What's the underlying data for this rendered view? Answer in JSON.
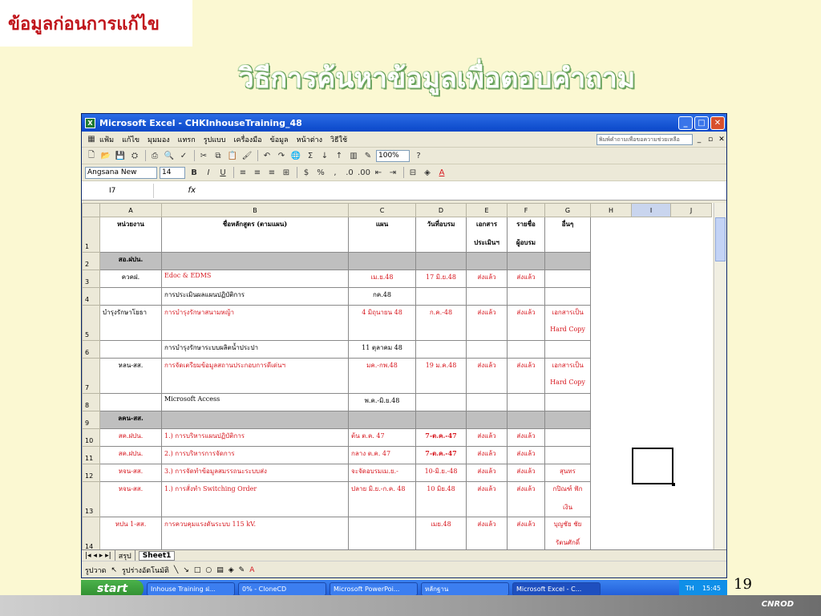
{
  "slide": {
    "tag": "ข้อมูลก่อนการแก้ไข",
    "title": "วิธีการค้นหาข้อมูลเพื่อตอบคำถาม",
    "page_number": "19",
    "footer": "CNROD"
  },
  "excel": {
    "window_title": "Microsoft Excel - CHKInhouseTraining_48",
    "menu": [
      "แฟ้ม",
      "แก้ไข",
      "มุมมอง",
      "แทรก",
      "รูปแบบ",
      "เครื่องมือ",
      "ข้อมูล",
      "หน้าต่าง",
      "วิธีใช้"
    ],
    "help_placeholder": "พิมพ์คำถามเพื่อขอความช่วยเหลือ",
    "font_name": "Angsana New",
    "font_size": "14",
    "zoom": "100%",
    "name_box": "I7",
    "fx_label": "fx",
    "columns": [
      "A",
      "B",
      "C",
      "D",
      "E",
      "F",
      "G",
      "H",
      "I",
      "J"
    ],
    "rows": [
      {
        "n": "1",
        "a": "หน่วยงาน",
        "b": "ชื่อหลักสูตร (ตามแผน)",
        "c": "แผน",
        "d": "วันที่อบรม",
        "e": "เอกสาร",
        "f": "รายชื่อ",
        "g": "อื่นๆ",
        "e2": "ประเมินฯ",
        "f2": "ผู้อบรม"
      },
      {
        "n": "2",
        "a": "สอ.ฝปน.",
        "gray": true
      },
      {
        "n": "3",
        "a": "ควคฝ.",
        "b": "Edoc & EDMS",
        "c": "เม.ย.48",
        "d": "17 มิ.ย.48",
        "e": "ส่งแล้ว",
        "f": "ส่งแล้ว",
        "g": ""
      },
      {
        "n": "4",
        "a": "",
        "b": "การประเมินผลแผนปฏิบัติการ",
        "c": "กค.48",
        "d": "",
        "e": "",
        "f": "",
        "g": ""
      },
      {
        "n": "5",
        "a": "บำรุงรักษาโยธา",
        "b": "การบำรุงรักษาสนามหญ้า",
        "c": "4 มิถุนายน 48",
        "d": "ก.ค.-48",
        "e": "ส่งแล้ว",
        "f": "ส่งแล้ว",
        "g": "เอกสารเป็น",
        "g2": "Hard Copy"
      },
      {
        "n": "6",
        "a": "",
        "b": "การบำรุงรักษาระบบผลิตน้ำประปา",
        "c": "11 ตุลาคม 48",
        "d": "",
        "e": "",
        "f": "",
        "g": ""
      },
      {
        "n": "7",
        "a": "หลน-สส.",
        "b": "การจัดเตรียมข้อมูลสถานประกอบการดีเด่นฯ",
        "c": "มค.-กพ.48",
        "d": "19 ม.ค.48",
        "e": "ส่งแล้ว",
        "f": "ส่งแล้ว",
        "g": "เอกสารเป็น",
        "g2": "Hard Copy"
      },
      {
        "n": "8",
        "a": "",
        "b": "Microsoft Access",
        "c": "พ.ค.-มิ.ย.48",
        "d": "",
        "e": "",
        "f": "",
        "g": ""
      },
      {
        "n": "9",
        "a": "ลคน-สส.",
        "gray": true
      },
      {
        "n": "10",
        "a": "สค.ฝปน.",
        "b": "1.) การบริหารแผนปฏิบัติการ",
        "c": "ต้น ต.ค. 47",
        "d": "7-ต.ค.-47",
        "e": "ส่งแล้ว",
        "f": "ส่งแล้ว",
        "g": ""
      },
      {
        "n": "11",
        "a": "สค.ฝปน.",
        "b": "2.) การบริหารการจัดการ",
        "c": "กลาง ต.ค. 47",
        "d": "7-ต.ค.-47",
        "e": "ส่งแล้ว",
        "f": "ส่งแล้ว",
        "g": ""
      },
      {
        "n": "12",
        "a": "หจน-สส.",
        "b": "3.) การจัดทำข้อมูลสมรรถนะระบบส่ง",
        "c": "จะจัดอบรมเม.ย.-",
        "d": "10-มิ.ย.-48",
        "e": "ส่งแล้ว",
        "f": "ส่งแล้ว",
        "g": "สุนทร"
      },
      {
        "n": "13",
        "a": "หจน-สส.",
        "b": "1.) การสั่งทำ Switching Order",
        "c": "ปลาย มิ.ย.-ก.ค. 48",
        "d": "10 มิย.48",
        "e": "ส่งแล้ว",
        "f": "ส่งแล้ว",
        "g": "กปิณฑ์ ฟัก",
        "g2": "เงิน"
      },
      {
        "n": "14",
        "a": "หปน 1-สส.",
        "b": "การควบคุมแรงดันระบบ 115 kV.",
        "c": "",
        "d": "เมย.48",
        "e": "ส่งแล้ว",
        "f": "ส่งแล้ว",
        "g": "บุญชัย ชัย",
        "g2": "รัตนศักดิ์"
      }
    ],
    "sheet_tabs": [
      "สรุป",
      "Sheet1"
    ],
    "draw_menu": "รูปวาด",
    "autoshape_menu": "รูปร่างอัตโนมัติ"
  },
  "taskbar": {
    "start": "start",
    "tasks": [
      "Inhouse Training ฝ...",
      "0% - CloneCD",
      "Microsoft PowerPoi...",
      "หลักฐาน",
      "Microsoft Excel - C..."
    ],
    "lang": "TH",
    "clock": "15:45"
  }
}
